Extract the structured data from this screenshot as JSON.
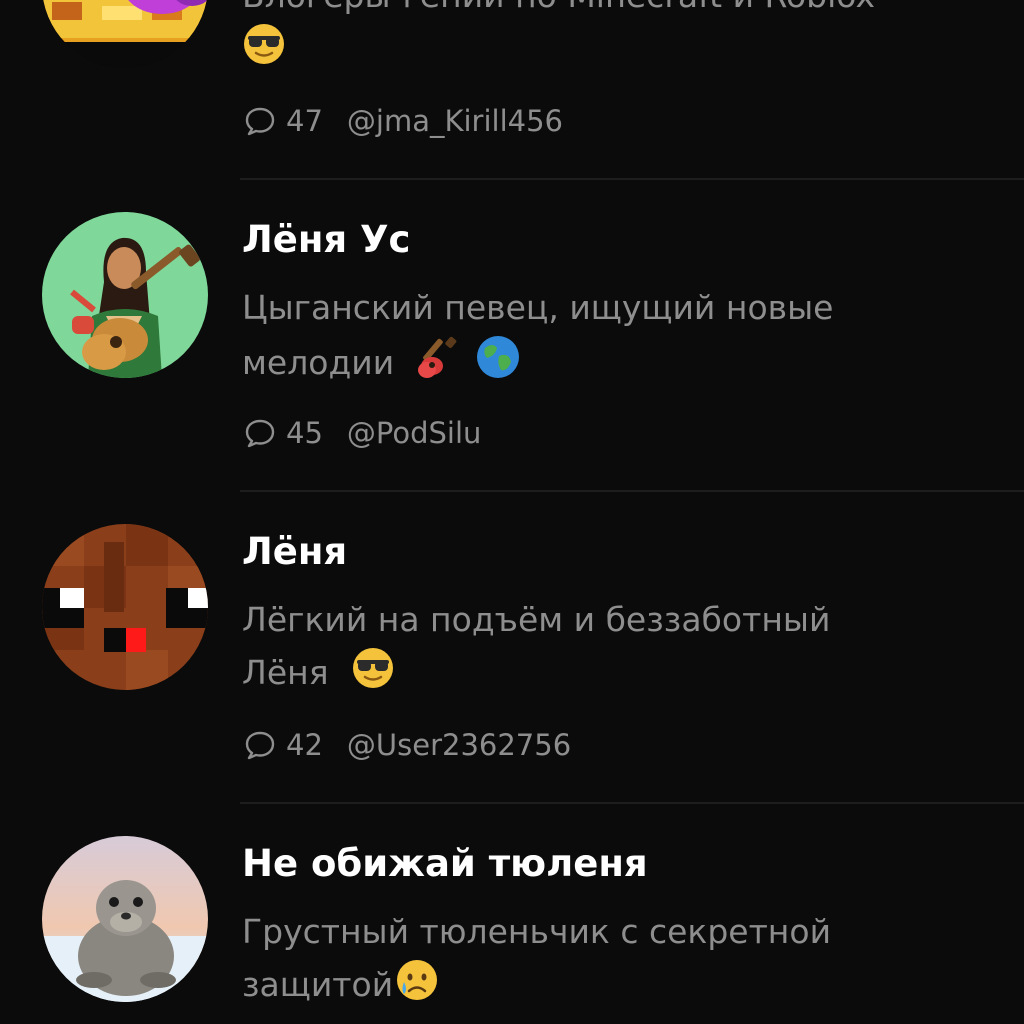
{
  "characters": [
    {
      "desc_line1": "Блогеры-гении по Minecraft и Roblox",
      "desc_emoji": "sunglasses-emoji",
      "comments": "47",
      "author": "@jma_Kirill456"
    },
    {
      "name": "Лёня Ус",
      "desc_line1": "Цыганский певец, ищущий новые",
      "desc_line2": "мелодии",
      "desc_emoji": "guitar-emoji globe-emoji",
      "comments": "45",
      "author": "@PodSilu"
    },
    {
      "name": "Лёня",
      "desc_line1": "Лёгкий на подъём и беззаботный",
      "desc_line2": "Лёня",
      "desc_emoji": "sunglasses-emoji",
      "comments": "42",
      "author": "@User2362756"
    },
    {
      "name": "Не обижай тюленя",
      "desc_line1": "Грустный тюленьчик с секретной",
      "desc_line2": "защитой",
      "desc_emoji": "crying-face-emoji"
    }
  ],
  "colors": {
    "background": "#0b0b0b",
    "name_text": "#ffffff",
    "secondary_text": "#8e8e8e",
    "divider": "#1d1d1d"
  },
  "icons": {
    "comment": "speech-bubble-icon"
  }
}
